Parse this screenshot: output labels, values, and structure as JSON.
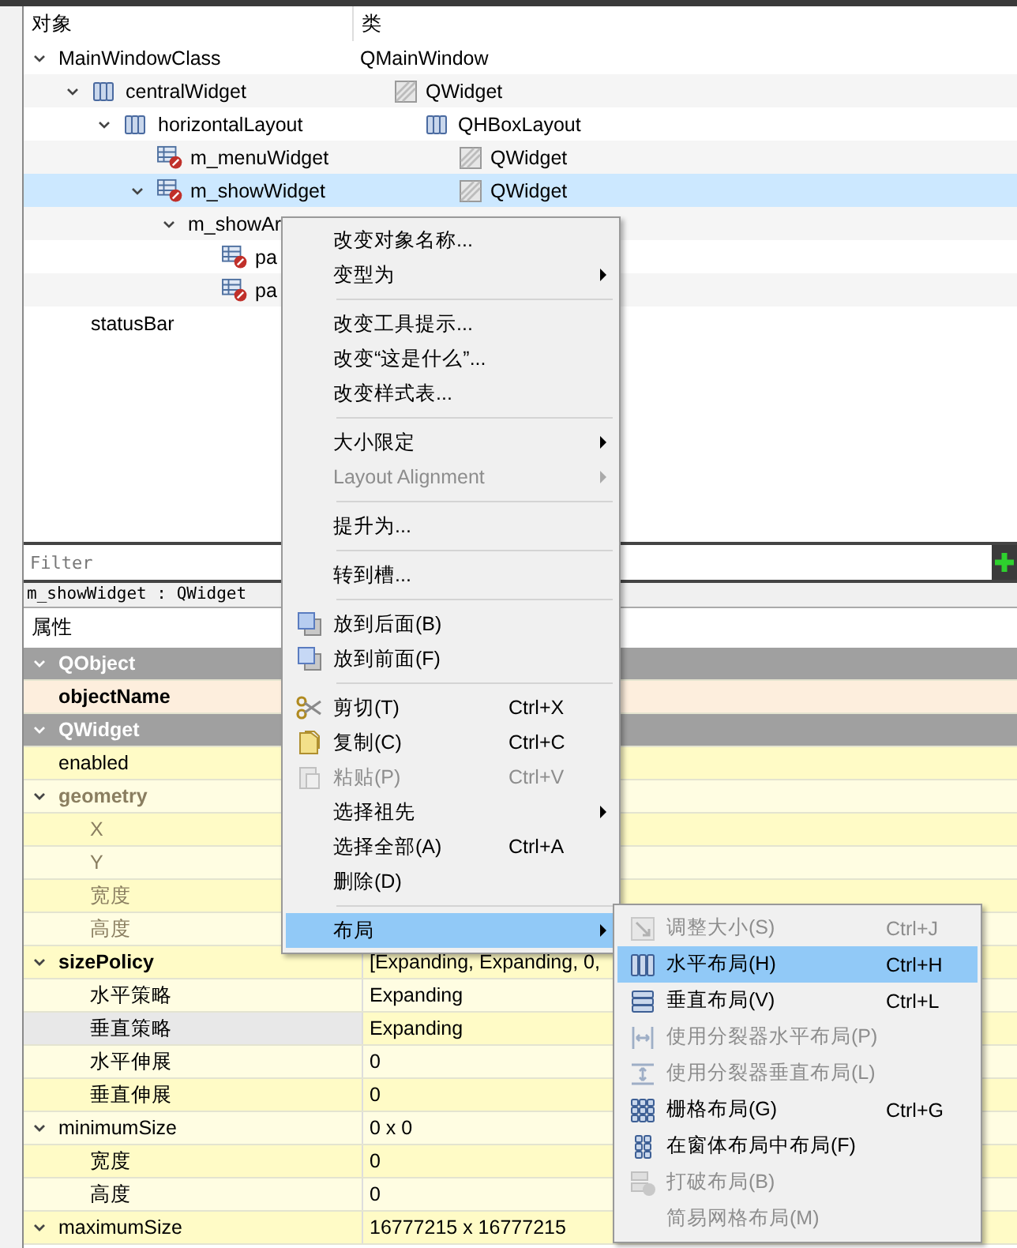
{
  "object_inspector": {
    "columns": [
      "对象",
      "类"
    ],
    "items": [
      {
        "name": "MainWindowClass",
        "class": "QMainWindow",
        "expanded": true,
        "selected": false,
        "children": [
          {
            "name": "centralWidget",
            "kind": "container",
            "class": "QWidget",
            "expanded": true,
            "selected": false,
            "children": [
              {
                "name": "horizontalLayout",
                "kind": "layout",
                "class": "QHBoxLayout",
                "expanded": true,
                "selected": false,
                "children": [
                  {
                    "name": "m_menuWidget",
                    "kind": "custom",
                    "class": "QWidget",
                    "selected": false
                  },
                  {
                    "name": "m_showWidget",
                    "kind": "custom",
                    "class": "QWidget",
                    "expanded": true,
                    "selected": true,
                    "children": [
                      {
                        "name": "m_showAr",
                        "expanded": true,
                        "selected": false,
                        "children": [
                          {
                            "name": "pa",
                            "kind": "custom",
                            "selected": false
                          },
                          {
                            "name": "pa",
                            "kind": "custom",
                            "selected": false
                          }
                        ]
                      }
                    ]
                  }
                ]
              }
            ]
          },
          {
            "name": "statusBar",
            "selected": false
          }
        ]
      }
    ]
  },
  "property_editor": {
    "filter": {
      "placeholder": "Filter"
    },
    "object_label": "m_showWidget : QWidget",
    "columns": [
      "属性"
    ],
    "rows": [
      {
        "kind": "section",
        "name": "QObject",
        "expanded": true
      },
      {
        "kind": "key",
        "name": "objectName",
        "modified": true
      },
      {
        "kind": "section",
        "name": "QWidget",
        "expanded": true
      },
      {
        "kind": "property",
        "name": "enabled"
      },
      {
        "kind": "group",
        "name": "geometry",
        "modified": true,
        "disabled": true,
        "expanded": true
      },
      {
        "kind": "sub",
        "name": "X",
        "disabled": true
      },
      {
        "kind": "sub",
        "name": "Y",
        "disabled": true
      },
      {
        "kind": "sub",
        "name": "宽度",
        "disabled": true
      },
      {
        "kind": "sub",
        "name": "高度",
        "disabled": true
      },
      {
        "kind": "group",
        "name": "sizePolicy",
        "modified": true,
        "expanded": true,
        "value": "[Expanding, Expanding, 0,"
      },
      {
        "kind": "sub",
        "name": "水平策略",
        "value": "Expanding"
      },
      {
        "kind": "sub",
        "name": "垂直策略",
        "value": "Expanding",
        "selected": true
      },
      {
        "kind": "sub",
        "name": "水平伸展",
        "value": "0"
      },
      {
        "kind": "sub",
        "name": "垂直伸展",
        "value": "0"
      },
      {
        "kind": "group",
        "name": "minimumSize",
        "expanded": true,
        "value": "0 x 0"
      },
      {
        "kind": "sub",
        "name": "宽度",
        "value": "0"
      },
      {
        "kind": "sub",
        "name": "高度",
        "value": "0"
      },
      {
        "kind": "group",
        "name": "maximumSize",
        "expanded": true,
        "value": "16777215 x 16777215"
      }
    ]
  },
  "context_menu": {
    "items": [
      {
        "kind": "plain",
        "label": "改变对象名称...",
        "disabled": false,
        "selected": false
      },
      {
        "kind": "plain",
        "label": "变型为",
        "submenu": true,
        "disabled": false,
        "selected": false
      },
      {
        "kind": "separator"
      },
      {
        "kind": "plain",
        "label": "改变工具提示...",
        "disabled": false,
        "selected": false
      },
      {
        "kind": "plain",
        "label": "改变“这是什么”...",
        "disabled": false,
        "selected": false
      },
      {
        "kind": "plain",
        "label": "改变样式表...",
        "disabled": false,
        "selected": false
      },
      {
        "kind": "separator"
      },
      {
        "kind": "plain",
        "label": "大小限定",
        "submenu": true,
        "disabled": false,
        "selected": false
      },
      {
        "kind": "plain",
        "label": "Layout Alignment",
        "submenu": true,
        "disabled": true,
        "selected": false
      },
      {
        "kind": "separator"
      },
      {
        "kind": "plain",
        "label": "提升为...",
        "disabled": false,
        "selected": false
      },
      {
        "kind": "separator"
      },
      {
        "kind": "plain",
        "label": "转到槽...",
        "disabled": false,
        "selected": false
      },
      {
        "kind": "separator"
      },
      {
        "kind": "back",
        "label": "放到后面(B)",
        "disabled": false,
        "selected": false
      },
      {
        "kind": "front",
        "label": "放到前面(F)",
        "disabled": false,
        "selected": false
      },
      {
        "kind": "separator"
      },
      {
        "kind": "cut",
        "label": "剪切(T)",
        "shortcut": "Ctrl+X",
        "disabled": false,
        "selected": false
      },
      {
        "kind": "copy",
        "label": "复制(C)",
        "shortcut": "Ctrl+C",
        "disabled": false,
        "selected": false
      },
      {
        "kind": "paste",
        "label": "粘贴(P)",
        "shortcut": "Ctrl+V",
        "disabled": true,
        "selected": false
      },
      {
        "kind": "plain",
        "label": "选择祖先",
        "submenu": true,
        "disabled": false,
        "selected": false
      },
      {
        "kind": "plain",
        "label": "选择全部(A)",
        "shortcut": "Ctrl+A",
        "disabled": false,
        "selected": false
      },
      {
        "kind": "plain",
        "label": "删除(D)",
        "disabled": false,
        "selected": false
      },
      {
        "kind": "separator"
      },
      {
        "kind": "plain",
        "label": "布局",
        "submenu": true,
        "disabled": false,
        "selected": true
      }
    ]
  },
  "layout_submenu": {
    "items": [
      {
        "kind": "adjust",
        "label": "调整大小(S)",
        "shortcut": "Ctrl+J",
        "disabled": true,
        "selected": false
      },
      {
        "kind": "hbox",
        "label": "水平布局(H)",
        "shortcut": "Ctrl+H",
        "disabled": false,
        "selected": true
      },
      {
        "kind": "vbox",
        "label": "垂直布局(V)",
        "shortcut": "Ctrl+L",
        "disabled": false,
        "selected": false
      },
      {
        "kind": "hsplit",
        "label": "使用分裂器水平布局(P)",
        "disabled": true,
        "selected": false
      },
      {
        "kind": "vsplit",
        "label": "使用分裂器垂直布局(L)",
        "disabled": true,
        "selected": false
      },
      {
        "kind": "grid",
        "label": "栅格布局(G)",
        "shortcut": "Ctrl+G",
        "disabled": false,
        "selected": false
      },
      {
        "kind": "form",
        "label": "在窗体布局中布局(F)",
        "disabled": false,
        "selected": false
      },
      {
        "kind": "break",
        "label": "打破布局(B)",
        "disabled": true,
        "selected": false
      },
      {
        "kind": "plain",
        "label": "简易网格布局(M)",
        "disabled": true,
        "selected": false
      }
    ]
  }
}
